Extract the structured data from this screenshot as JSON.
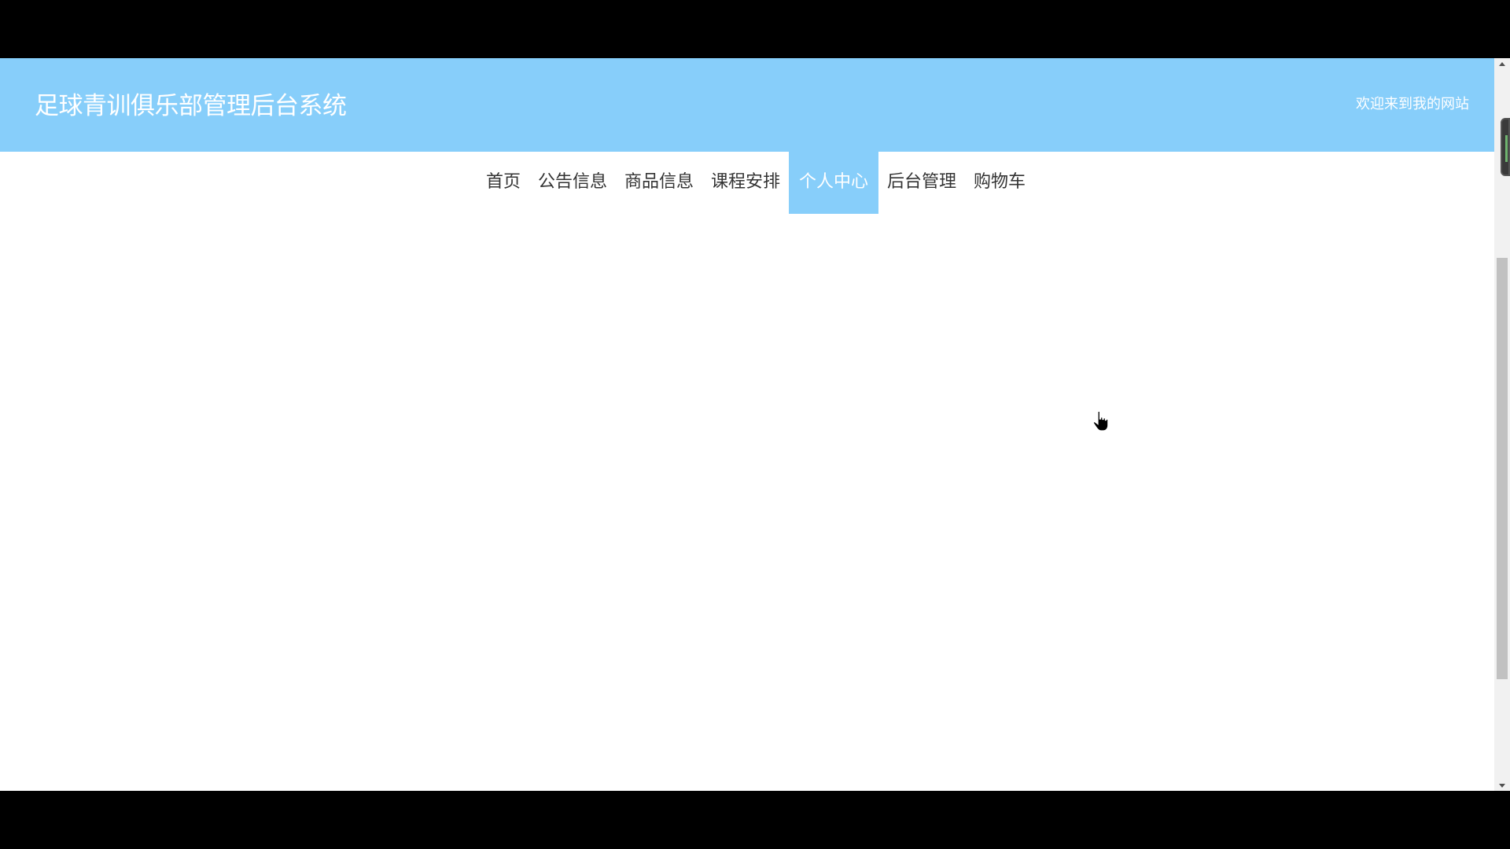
{
  "header": {
    "title": "足球青训俱乐部管理后台系统",
    "welcome": "欢迎来到我的网站"
  },
  "nav": {
    "items": [
      {
        "label": "首页",
        "active": false
      },
      {
        "label": "公告信息",
        "active": false
      },
      {
        "label": "商品信息",
        "active": false
      },
      {
        "label": "课程安排",
        "active": false
      },
      {
        "label": "个人中心",
        "active": true
      },
      {
        "label": "后台管理",
        "active": false
      },
      {
        "label": "购物车",
        "active": false
      }
    ]
  },
  "colors": {
    "header_bg": "#87cefa",
    "active_tab_bg": "#87cefa",
    "text_white": "#ffffff",
    "nav_text": "#333333"
  },
  "icons": {
    "cursor": "hand-pointer-icon",
    "scroll_up": "arrow-up-icon",
    "scroll_down": "arrow-down-icon"
  }
}
